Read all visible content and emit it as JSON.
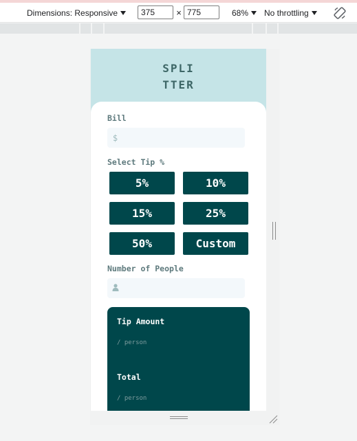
{
  "devtools": {
    "dimensions_label": "Dimensions: Responsive",
    "width_value": "375",
    "height_value": "775",
    "times_symbol": "×",
    "zoom_label": "68%",
    "throttling_label": "No throttling",
    "rotate_icon": "rotate-icon"
  },
  "app": {
    "logo_line1": "SPLI",
    "logo_line2": "TTER",
    "bill_label": "Bill",
    "bill_prefix": "$",
    "bill_value": "",
    "tip_label": "Select Tip %",
    "tip_options": [
      "5%",
      "10%",
      "15%",
      "25%",
      "50%",
      "Custom"
    ],
    "people_label": "Number of People",
    "people_icon": "person-icon",
    "people_value": "",
    "results": {
      "tip_amount_label": "Tip Amount",
      "tip_amount_sub": "/ person",
      "total_label": "Total",
      "total_sub": "/ person"
    }
  },
  "colors": {
    "header_bg": "#c5e4e7",
    "primary": "#00474b",
    "label": "#5e7a7d",
    "input_bg": "#f3f8fb"
  }
}
